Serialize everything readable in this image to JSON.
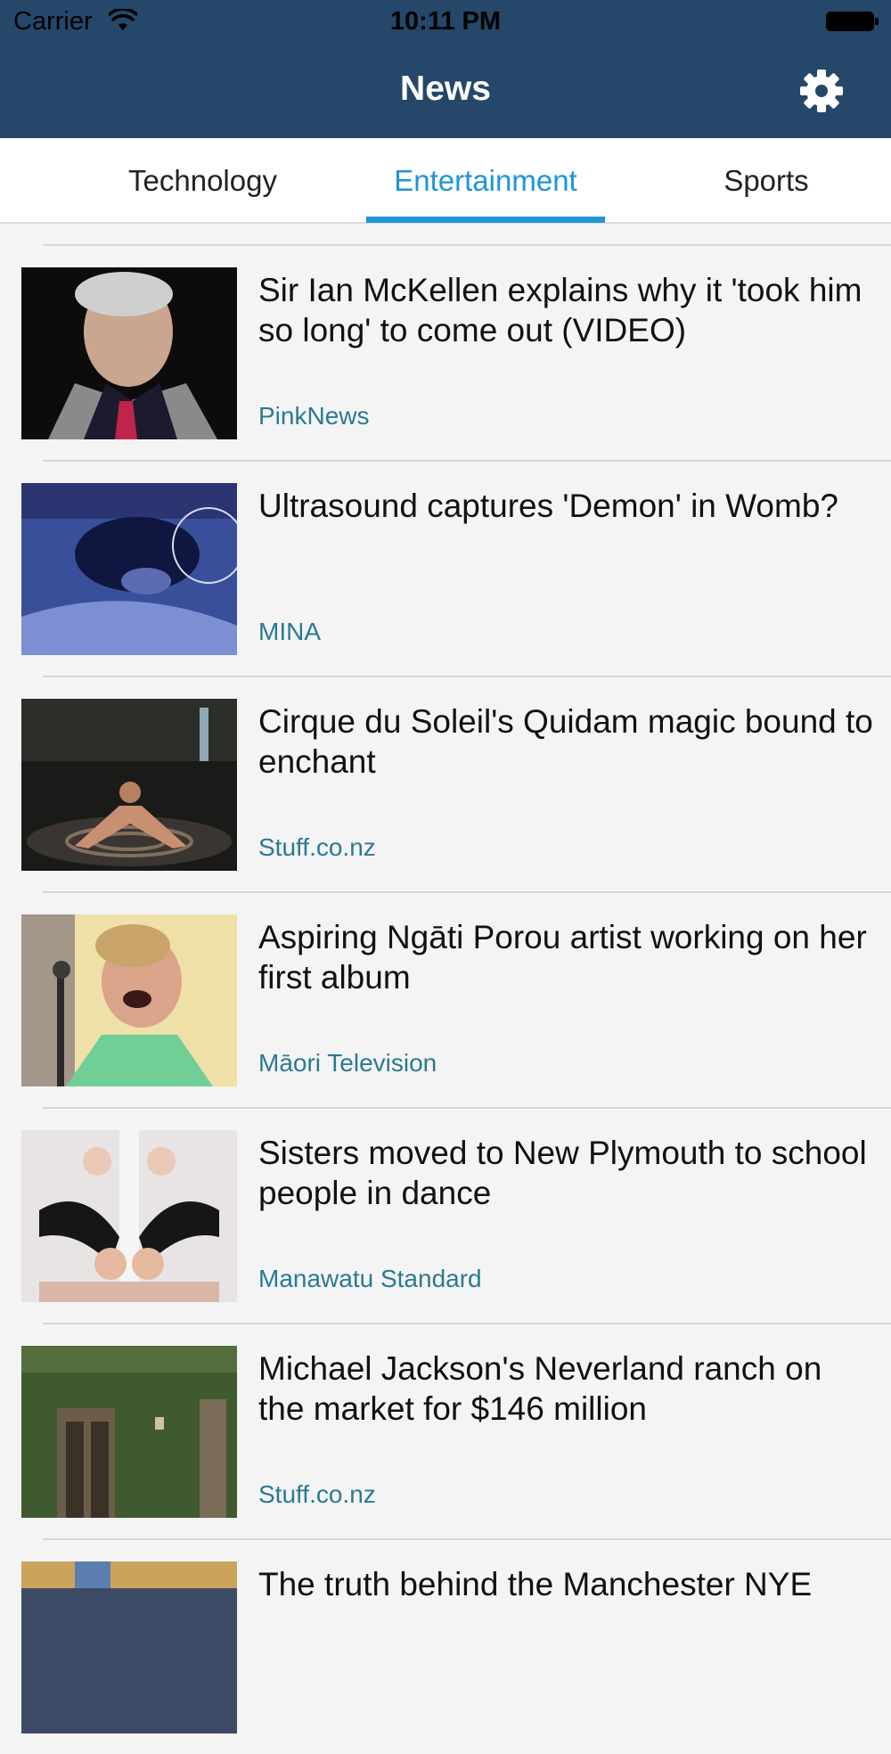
{
  "status_bar": {
    "carrier": "Carrier",
    "time": "10:11 PM"
  },
  "nav": {
    "title": "News",
    "settings_icon": "gear-icon"
  },
  "tabs": [
    {
      "label": "Technology",
      "selected": false
    },
    {
      "label": "Entertainment",
      "selected": true
    },
    {
      "label": "Sports",
      "selected": false
    }
  ],
  "colors": {
    "nav_bg": "#25476a",
    "accent": "#1e95d6",
    "source": "#2a7a92"
  },
  "articles": [
    {
      "headline": "Sir Ian McKellen explains why it 'took him so long' to come out (VIDEO)",
      "source": "PinkNews"
    },
    {
      "headline": "Ultrasound captures 'Demon' in Womb?",
      "source": "MINA"
    },
    {
      "headline": "Cirque du Soleil's Quidam magic bound to enchant",
      "source": "Stuff.co.nz"
    },
    {
      "headline": "Aspiring Ngāti Porou artist working on her first album",
      "source": "Māori Television"
    },
    {
      "headline": "Sisters moved to New Plymouth to school people in dance",
      "source": "Manawatu Standard"
    },
    {
      "headline": "Michael Jackson's Neverland ranch on the market for $146 million",
      "source": "Stuff.co.nz"
    },
    {
      "headline": "The truth behind the Manchester NYE",
      "source": ""
    }
  ]
}
